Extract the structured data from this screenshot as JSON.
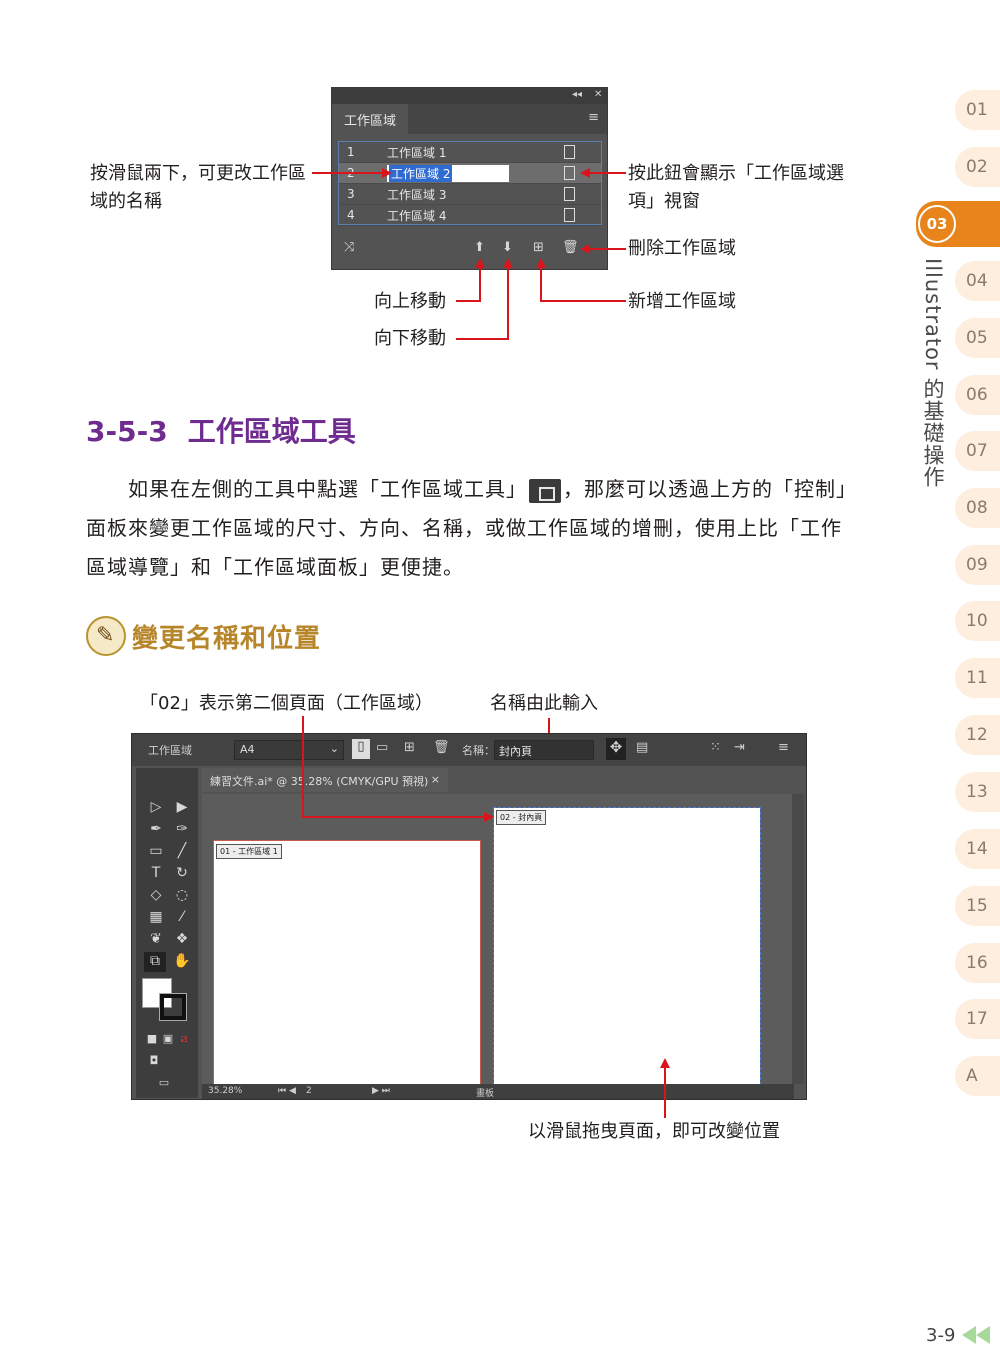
{
  "panel": {
    "header_controls": [
      "◂◂",
      "✕"
    ],
    "tab_label": "工作區域",
    "menu_icon": "hamburger-icon",
    "rows": [
      {
        "num": "1",
        "name": "工作區域 1"
      },
      {
        "num": "2",
        "name": "工作區域 2"
      },
      {
        "num": "3",
        "name": "工作區域 3"
      },
      {
        "num": "4",
        "name": "工作區域 4"
      }
    ]
  },
  "callouts": {
    "rename": "按滑鼠兩下，可更改工作區域的名稱",
    "options": "按此鈕會顯示「工作區域選項」視窗",
    "delete": "刪除工作區域",
    "new": "新增工作區域",
    "move_up": "向上移動",
    "move_down": "向下移動"
  },
  "section": {
    "number": "3-5-3",
    "title": "工作區域工具"
  },
  "paragraph": {
    "part1": "如果在左側的工具中點選「工作區域工具」",
    "part2": "，那麼可以透過上方的「控制」面板來變更工作區域的尺寸、方向、名稱，或做工作區域的增刪，使用上比「工作區域導覽」和「工作區域面板」更便捷。"
  },
  "subheading": "變更名稱和位置",
  "figure2": {
    "label_page": "「02」表示第二個頁面（工作區域）",
    "label_name": "名稱由此輸入",
    "label_drag": "以滑鼠拖曳頁面，即可改變位置"
  },
  "illustrator": {
    "ctrl_label": "工作區域",
    "preset": "A4",
    "name_label": "名稱：",
    "name_value": "封內頁",
    "doc_tab": "練習文件.ai* @ 35.28% (CMYK/GPU 預視)",
    "doc_tab_close": "×",
    "artboard1_label": "01 - 工作區域 1",
    "artboard2_label": "02 - 封內頁",
    "zoom": "35.28%",
    "page_field": "2",
    "status_label": "畫板"
  },
  "chapter_tabs": [
    "01",
    "02",
    "03",
    "04",
    "05",
    "06",
    "07",
    "08",
    "09",
    "10",
    "11",
    "12",
    "13",
    "14",
    "15",
    "16",
    "17",
    "A"
  ],
  "chapter_title": "Illustrator 的基礎操作",
  "page_number": "3-9",
  "colors": {
    "accent_orange": "#e8841c",
    "section_purple": "#6f2c8f",
    "subhead_gold": "#b8862a",
    "callout_red": "#d9141b"
  }
}
